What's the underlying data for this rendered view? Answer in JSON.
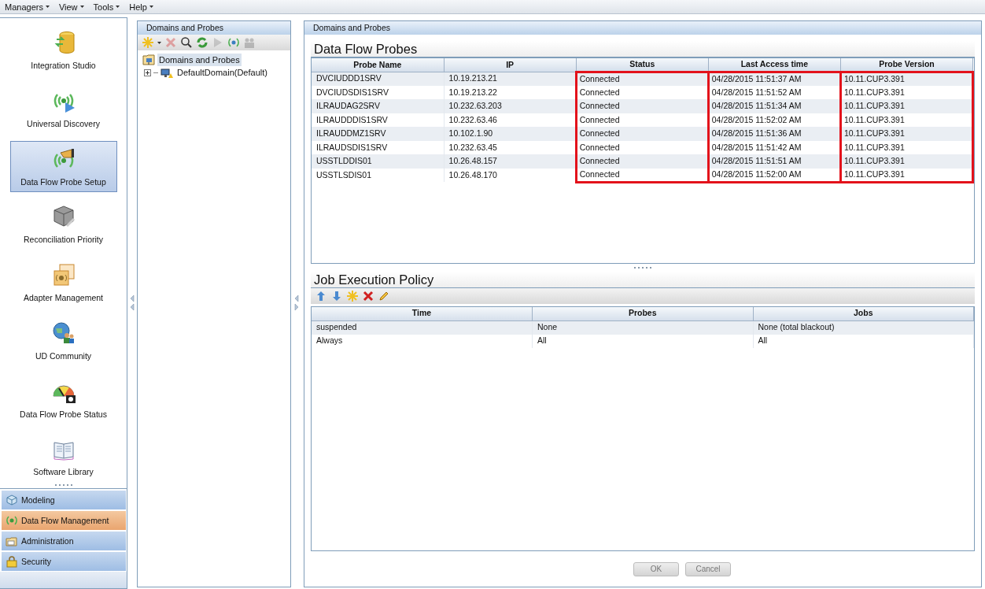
{
  "menu": [
    {
      "label": "Managers"
    },
    {
      "label": "View"
    },
    {
      "label": "Tools"
    },
    {
      "label": "Help"
    }
  ],
  "sidebar": {
    "items": [
      {
        "label": "Integration Studio",
        "selected": false
      },
      {
        "label": "Universal Discovery",
        "selected": false
      },
      {
        "label": "Data Flow Probe Setup",
        "selected": true
      },
      {
        "label": "Reconciliation Priority",
        "selected": false
      },
      {
        "label": "Adapter Management",
        "selected": false
      },
      {
        "label": "UD Community",
        "selected": false
      },
      {
        "label": "Data Flow Probe Status",
        "selected": false
      },
      {
        "label": "Software Library",
        "selected": false
      }
    ],
    "sections": [
      {
        "label": "Modeling",
        "selected": false
      },
      {
        "label": "Data Flow Management",
        "selected": true
      },
      {
        "label": "Administration",
        "selected": false
      },
      {
        "label": "Security",
        "selected": false
      }
    ]
  },
  "tree_panel": {
    "title": "Domains and Probes",
    "toolbar": [
      {
        "kind": "new",
        "disabled": false
      },
      {
        "kind": "delete",
        "disabled": true
      },
      {
        "kind": "search",
        "disabled": false
      },
      {
        "kind": "refresh",
        "disabled": false
      },
      {
        "kind": "play",
        "disabled": true
      },
      {
        "kind": "probe",
        "disabled": false
      },
      {
        "kind": "people",
        "disabled": true
      }
    ],
    "tree": [
      {
        "label": "Domains and Probes",
        "selected": true,
        "children": [
          {
            "label": "DefaultDomain(Default)",
            "selected": false,
            "expanded": false
          }
        ]
      }
    ]
  },
  "main": {
    "title": "Domains and Probes",
    "probes": {
      "title": "Data Flow Probes",
      "columns": [
        {
          "label": "Probe Name",
          "highlighted": false
        },
        {
          "label": "IP",
          "highlighted": false
        },
        {
          "label": "Status",
          "highlighted": true
        },
        {
          "label": "Last Access time",
          "highlighted": true
        },
        {
          "label": "Probe Version",
          "highlighted": true
        }
      ],
      "rows": [
        [
          "DVCIUDDD1SRV",
          "10.19.213.21",
          "Connected",
          "04/28/2015 11:51:37 AM",
          "10.11.CUP3.391"
        ],
        [
          "DVCIUDSDIS1SRV",
          "10.19.213.22",
          "Connected",
          "04/28/2015 11:51:52 AM",
          "10.11.CUP3.391"
        ],
        [
          "ILRAUDAG2SRV",
          "10.232.63.203",
          "Connected",
          "04/28/2015 11:51:34 AM",
          "10.11.CUP3.391"
        ],
        [
          "ILRAUDDDIS1SRV",
          "10.232.63.46",
          "Connected",
          "04/28/2015 11:52:02 AM",
          "10.11.CUP3.391"
        ],
        [
          "ILRAUDDMZ1SRV",
          "10.102.1.90",
          "Connected",
          "04/28/2015 11:51:36 AM",
          "10.11.CUP3.391"
        ],
        [
          "ILRAUDSDIS1SRV",
          "10.232.63.45",
          "Connected",
          "04/28/2015 11:51:42 AM",
          "10.11.CUP3.391"
        ],
        [
          "USSTLDDIS01",
          "10.26.48.157",
          "Connected",
          "04/28/2015 11:51:51 AM",
          "10.11.CUP3.391"
        ],
        [
          "USSTLSDIS01",
          "10.26.48.170",
          "Connected",
          "04/28/2015 11:52:00 AM",
          "10.11.CUP3.391"
        ]
      ]
    },
    "policy": {
      "title": "Job Execution Policy",
      "toolbar": [
        {
          "kind": "up"
        },
        {
          "kind": "down"
        },
        {
          "kind": "new"
        },
        {
          "kind": "delete"
        },
        {
          "kind": "edit"
        }
      ],
      "columns": [
        "Time",
        "Probes",
        "Jobs"
      ],
      "rows": [
        [
          "suspended",
          "None",
          "None (total blackout)"
        ],
        [
          "Always",
          "All",
          "All"
        ]
      ]
    },
    "buttons": [
      {
        "label": "OK",
        "disabled": true
      },
      {
        "label": "Cancel",
        "disabled": true
      }
    ]
  }
}
